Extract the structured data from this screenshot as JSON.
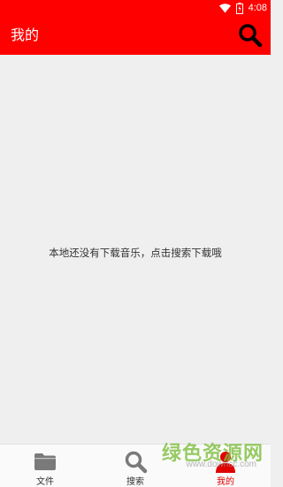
{
  "status_bar": {
    "time": "4:08"
  },
  "app_bar": {
    "title": "我的"
  },
  "content": {
    "empty_message": "本地还没有下载音乐，点击搜索下载哦"
  },
  "bottom_nav": {
    "items": [
      {
        "label": "文件",
        "icon": "folder-icon"
      },
      {
        "label": "搜索",
        "icon": "search-icon"
      },
      {
        "label": "我的",
        "icon": "profile-icon"
      }
    ],
    "active_index": 2
  },
  "watermark": {
    "text": "绿色资源网",
    "url": "www.downcc.com"
  },
  "colors": {
    "primary": "#ff0000",
    "background": "#efefef",
    "nav_inactive": "#7a7a7a",
    "nav_active": "#e00000"
  }
}
